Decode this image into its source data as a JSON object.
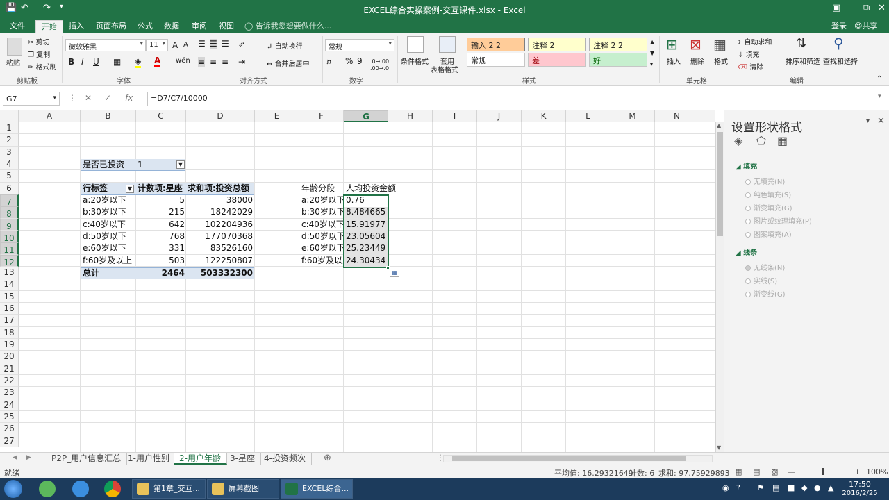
{
  "window": {
    "title": "EXCEL综合实操案例-交互课件.xlsx - Excel"
  },
  "menu": {
    "tabs": [
      "文件",
      "开始",
      "插入",
      "页面布局",
      "公式",
      "数据",
      "审阅",
      "视图"
    ],
    "active": "开始",
    "tell_me": "告诉我您想要做什么...",
    "login": "登录",
    "share": "共享"
  },
  "ribbon": {
    "clipboard": {
      "paste": "粘贴",
      "cut": "剪切",
      "copy": "复制",
      "format_painter": "格式刷",
      "label": "剪贴板"
    },
    "font": {
      "name": "微软雅黑",
      "size": "11",
      "bold": "B",
      "italic": "I",
      "underline": "U",
      "label": "字体",
      "grow": "A",
      "shrink": "A",
      "wen": "wén"
    },
    "alignment": {
      "wrap": "自动换行",
      "merge": "合并后居中",
      "label": "对齐方式"
    },
    "number": {
      "format": "常规",
      "percent": "%",
      "comma": "9",
      "inc_dec": ".0→.00",
      "dec_dec": ".00→.0",
      "label": "数字"
    },
    "styles": {
      "conditional": "条件格式",
      "table_format_1": "套用",
      "table_format_2": "表格格式",
      "cells": [
        "输入 2 2",
        "注释 2",
        "注释 2 2",
        "常规",
        "差",
        "好"
      ],
      "label": "样式"
    },
    "cells_group": {
      "insert": "插入",
      "delete": "删除",
      "format": "格式",
      "label": "单元格"
    },
    "editing": {
      "autosum": "自动求和",
      "fill": "填充",
      "clear": "清除",
      "sort": "排序和筛选",
      "find": "查找和选择",
      "label": "编辑"
    }
  },
  "formula_bar": {
    "name_box": "G7",
    "formula": "=D7/C7/10000",
    "fx": "fx"
  },
  "columns": [
    "A",
    "B",
    "C",
    "D",
    "E",
    "F",
    "G",
    "H",
    "I",
    "J",
    "K",
    "L",
    "M",
    "N"
  ],
  "rows": [
    "1",
    "2",
    "3",
    "4",
    "5",
    "6",
    "7",
    "8",
    "9",
    "10",
    "11",
    "12",
    "13",
    "14",
    "15",
    "16",
    "17",
    "18",
    "19",
    "20",
    "21",
    "22",
    "23",
    "24",
    "25",
    "26",
    "27"
  ],
  "pivot": {
    "filter_label": "是否已投资",
    "filter_value": "1",
    "headers": [
      "行标签",
      "计数项:星座",
      "求和项:投资总额"
    ],
    "rows": [
      [
        "a:20岁以下",
        "5",
        "38000"
      ],
      [
        "b:30岁以下",
        "215",
        "18242029"
      ],
      [
        "c:40岁以下",
        "642",
        "102204936"
      ],
      [
        "d:50岁以下",
        "768",
        "177070368"
      ],
      [
        "e:60岁以下",
        "331",
        "83526160"
      ],
      [
        "f:60岁及以上",
        "503",
        "122250807"
      ]
    ],
    "total": [
      "总计",
      "2464",
      "503332300"
    ]
  },
  "avg_table": {
    "headers": [
      "年龄分段",
      "人均投资金额"
    ],
    "rows": [
      [
        "a:20岁以下",
        "0.76"
      ],
      [
        "b:30岁以下",
        "8.484665"
      ],
      [
        "c:40岁以下",
        "15.91977"
      ],
      [
        "d:50岁以下",
        "23.05604"
      ],
      [
        "e:60岁以下",
        "25.23449"
      ],
      [
        "f:60岁及以上",
        "24.30434"
      ]
    ]
  },
  "panel": {
    "title": "设置形状格式",
    "fill_section": "填充",
    "fill_options": [
      "无填充(N)",
      "纯色填充(S)",
      "渐变填充(G)",
      "图片或纹理填充(P)",
      "图案填充(A)"
    ],
    "line_section": "线条",
    "line_options": [
      "无线条(N)",
      "实线(S)",
      "渐变线(G)"
    ]
  },
  "sheets": {
    "tabs": [
      "P2P_用户信息汇总",
      "1-用户性别",
      "2-用户年龄",
      "3-星座",
      "4-投资频次"
    ],
    "active": "2-用户年龄"
  },
  "status": {
    "ready": "就绪",
    "average": "平均值: 16.29321649",
    "count": "计数: 6",
    "sum": "求和: 97.75929893",
    "zoom": "100%"
  },
  "taskbar": {
    "items": [
      "第1章_交互...",
      "屏幕截图",
      "EXCEL综合..."
    ],
    "time": "17:50",
    "date": "2016/2/25"
  },
  "colors": {
    "accent": "#217346",
    "pivot_header": "#dbe5f1",
    "input_style": "#ffcc99",
    "note_style": "#ffffcc",
    "bad_style": "#ffc7ce",
    "good_style": "#c6efce"
  }
}
